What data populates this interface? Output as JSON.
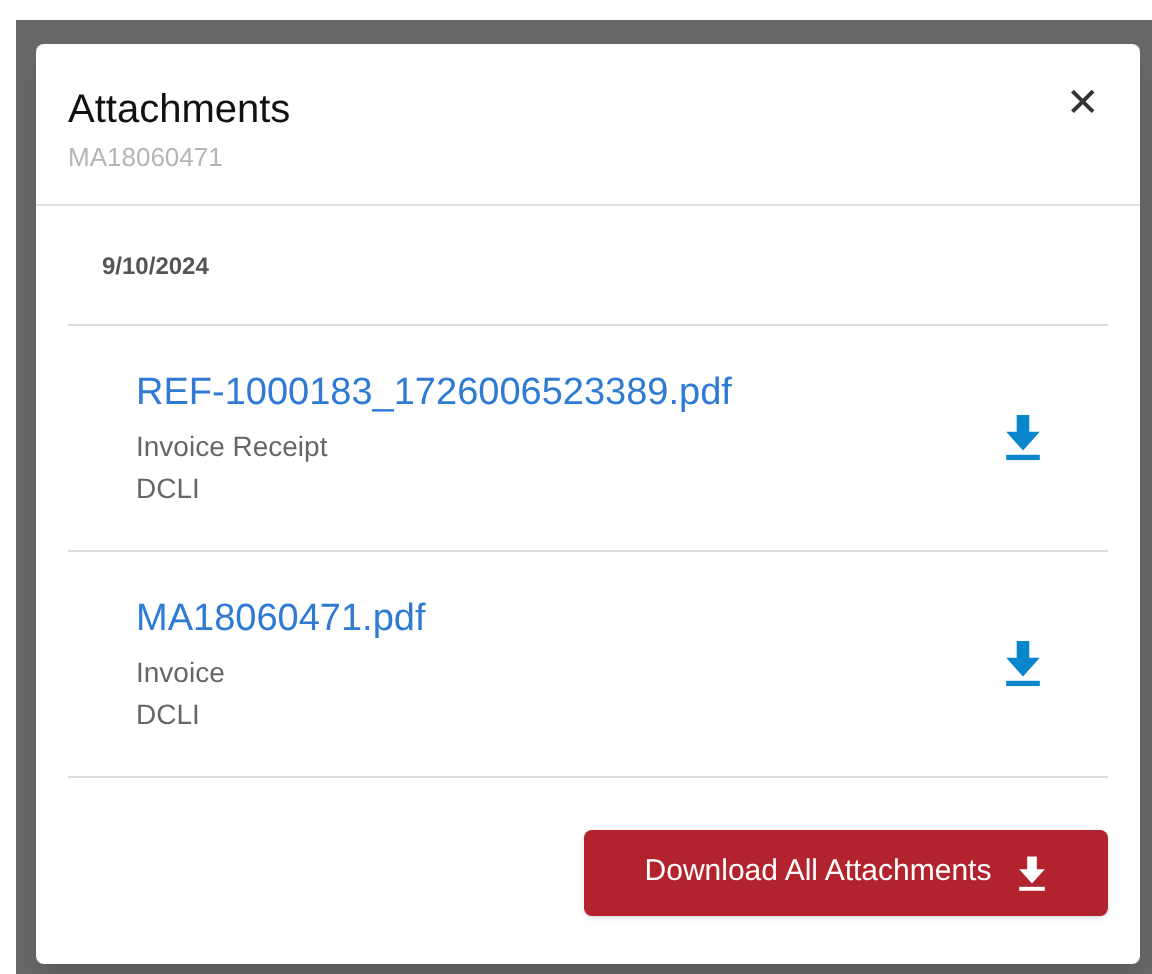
{
  "dialog": {
    "title": "Attachments",
    "subtitle": "MA18060471",
    "close_label": "✕"
  },
  "groups": [
    {
      "date": "9/10/2024",
      "attachments": [
        {
          "file_name": "REF-1000183_1726006523389.pdf",
          "type": "Invoice Receipt",
          "source": "DCLI"
        },
        {
          "file_name": "MA18060471.pdf",
          "type": "Invoice",
          "source": "DCLI"
        }
      ]
    }
  ],
  "download_all_button": {
    "label": "Download All Attachments"
  }
}
